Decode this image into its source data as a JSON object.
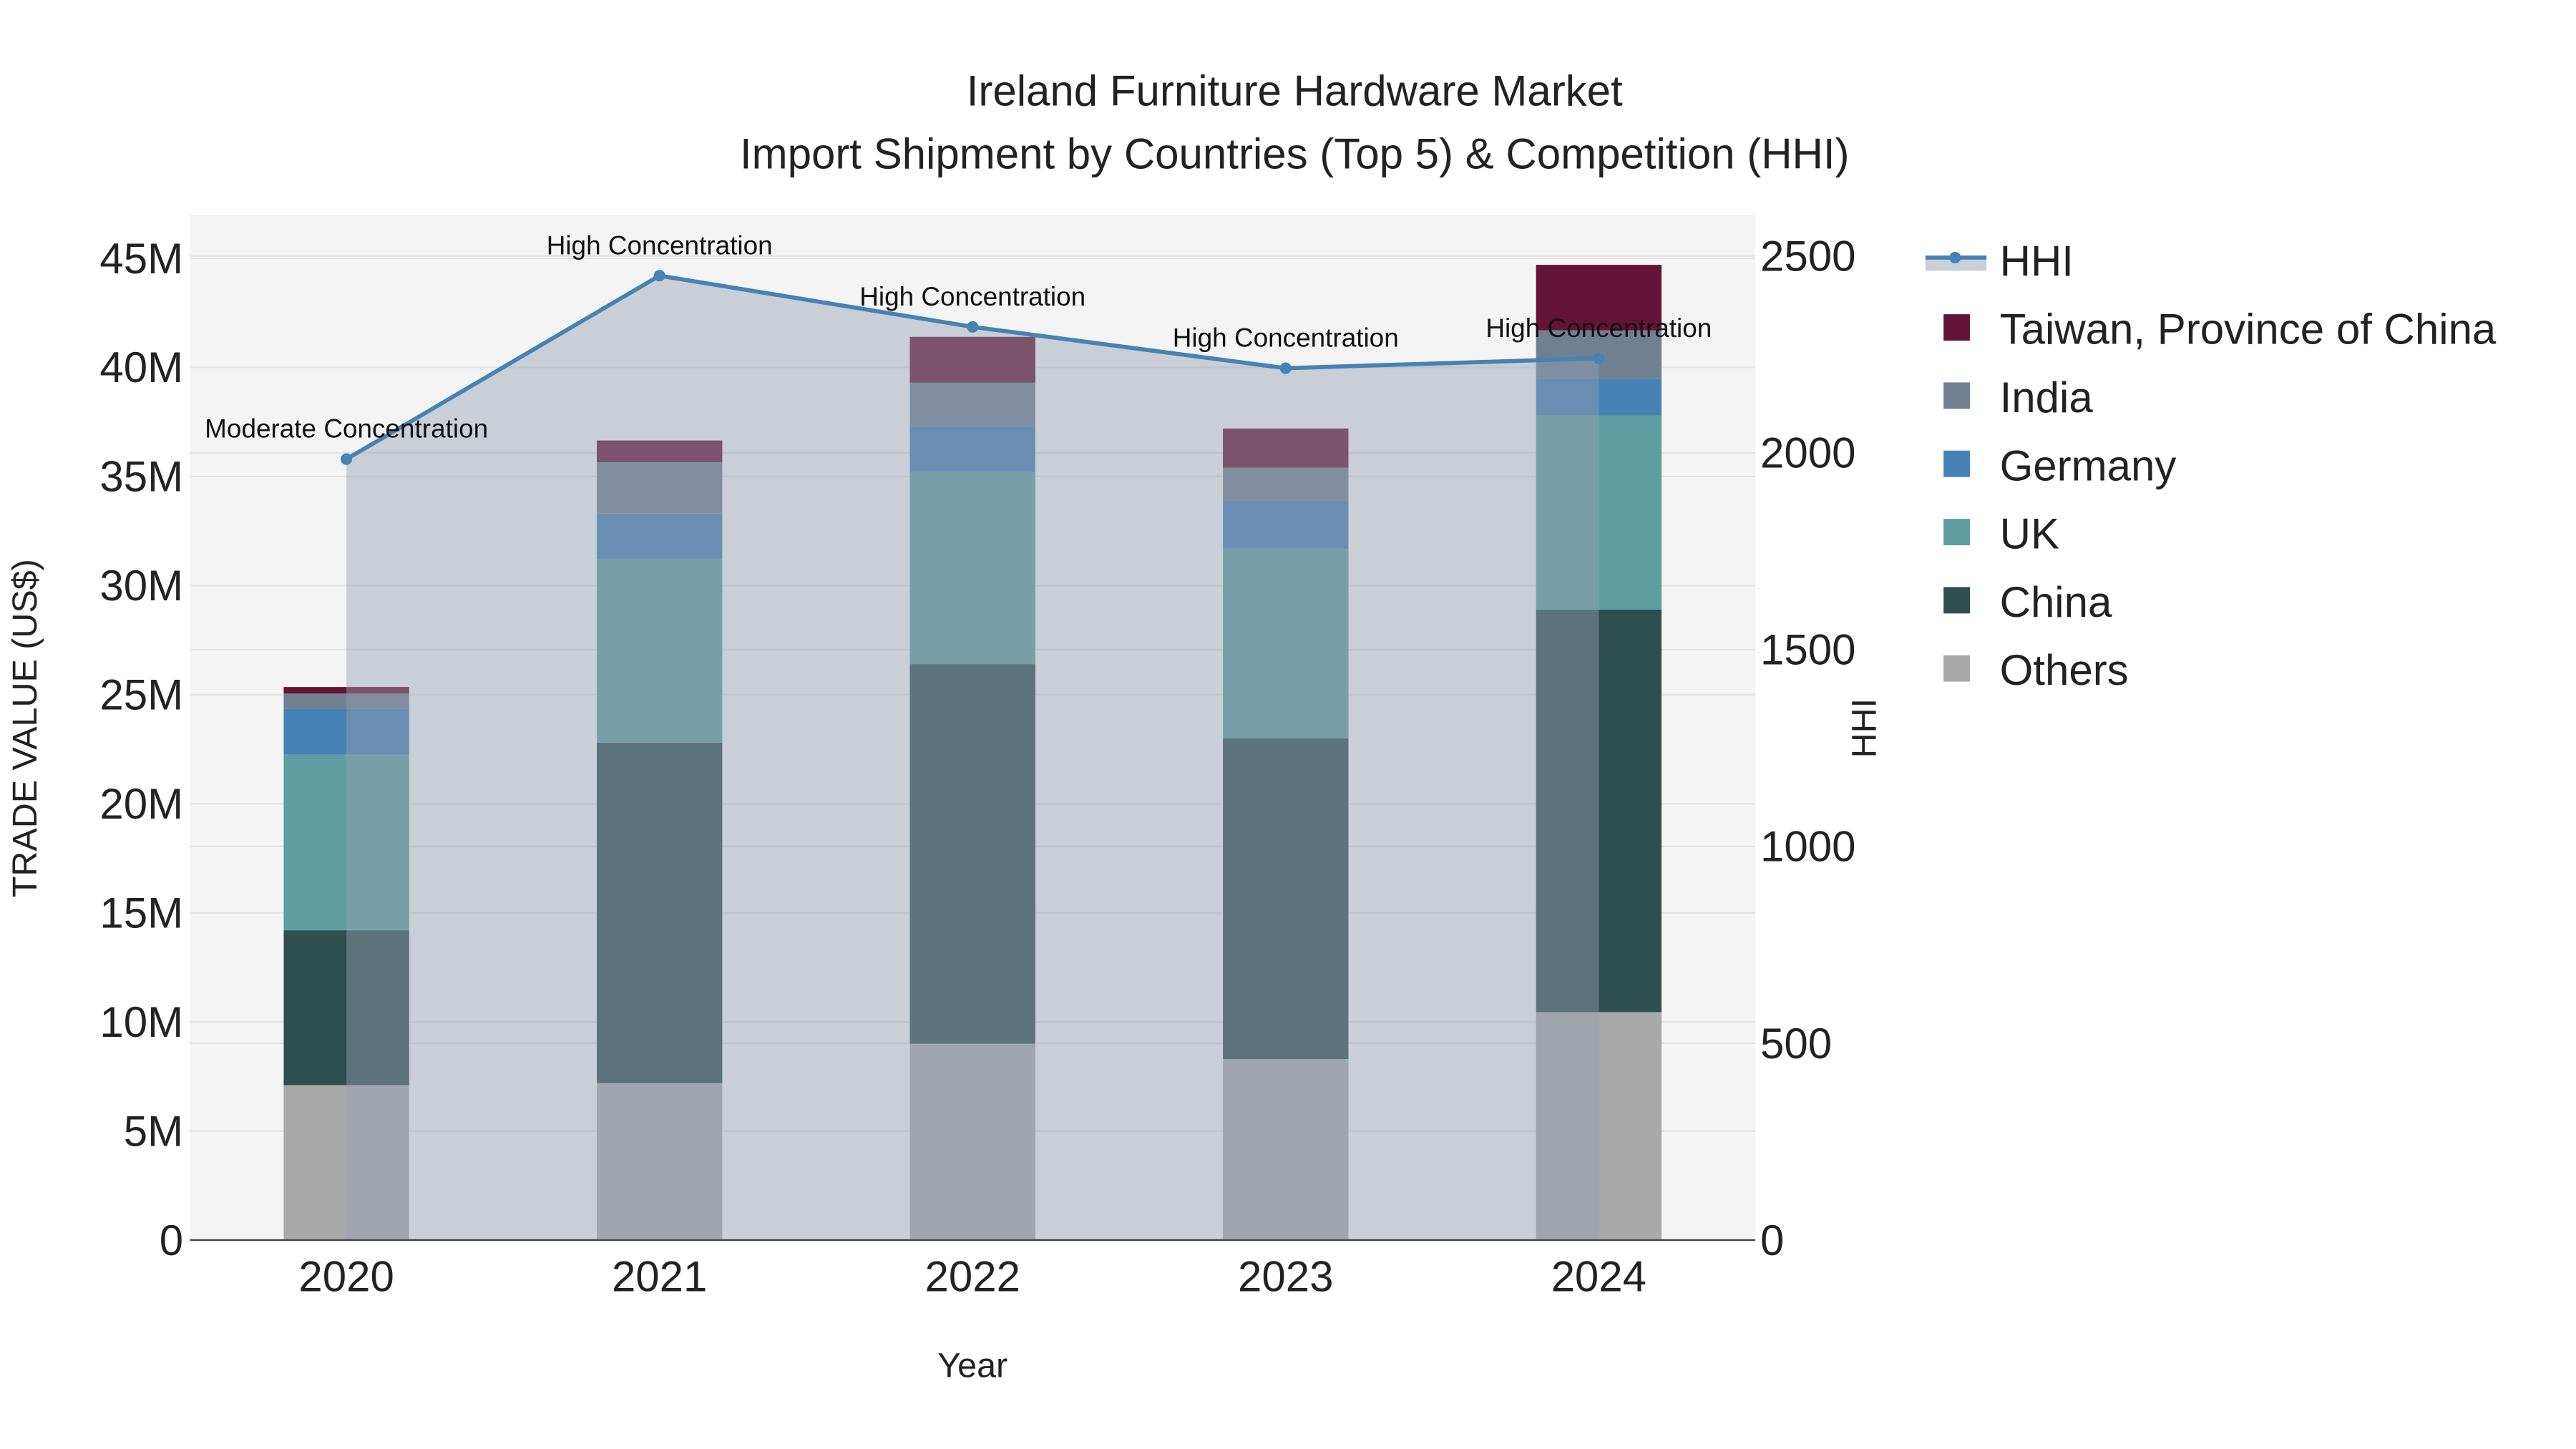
{
  "chart_data": {
    "type": "bar",
    "title_line1": "Ireland Furniture Hardware Market",
    "title_line2": "Import Shipment by Countries (Top 5) & Competition (HHI)",
    "xlabel": "Year",
    "ylabel": "TRADE VALUE (US$)",
    "y2label": "HHI",
    "categories": [
      "2020",
      "2021",
      "2022",
      "2023",
      "2024"
    ],
    "ylim": [
      0,
      47000000
    ],
    "y_ticks": [
      0,
      5000000,
      10000000,
      15000000,
      20000000,
      25000000,
      30000000,
      35000000,
      40000000,
      45000000
    ],
    "y_tick_labels": [
      "0",
      "5M",
      "10M",
      "15M",
      "20M",
      "25M",
      "30M",
      "35M",
      "40M",
      "45M"
    ],
    "y2lim": [
      0,
      2605
    ],
    "y2_ticks": [
      0,
      500,
      1000,
      1500,
      2000,
      2500
    ],
    "y2_tick_labels": [
      "0",
      "500",
      "1000",
      "1500",
      "2000",
      "2500"
    ],
    "stacked": true,
    "series": [
      {
        "name": "Others",
        "color": "#A9A9A9",
        "values": [
          7100000,
          7200000,
          9000000,
          8300000,
          10450000
        ]
      },
      {
        "name": "China",
        "color": "#2F4F4F",
        "values": [
          7100000,
          15600000,
          17400000,
          14700000,
          18450000
        ]
      },
      {
        "name": "UK",
        "color": "#5F9EA0",
        "values": [
          8050000,
          8400000,
          8800000,
          8700000,
          8900000
        ]
      },
      {
        "name": "Germany",
        "color": "#4682B4",
        "values": [
          2100000,
          2100000,
          2100000,
          2200000,
          1700000
        ]
      },
      {
        "name": "India",
        "color": "#708090",
        "values": [
          700000,
          2350000,
          2000000,
          1500000,
          2200000
        ]
      },
      {
        "name": "Taiwan, Province of China",
        "color": "#641436",
        "values": [
          300000,
          1000000,
          2100000,
          1800000,
          3000000
        ]
      }
    ],
    "hhi": {
      "name": "HHI",
      "color": "#4682B4",
      "values": [
        1984,
        2450,
        2320,
        2215,
        2240
      ],
      "annotations": [
        "Moderate Concentration",
        "High Concentration",
        "High Concentration",
        "High Concentration",
        "High Concentration"
      ]
    },
    "legend_order": [
      "HHI",
      "Taiwan, Province of China",
      "India",
      "Germany",
      "UK",
      "China",
      "Others"
    ],
    "legend_placement": "right",
    "grid": true
  }
}
